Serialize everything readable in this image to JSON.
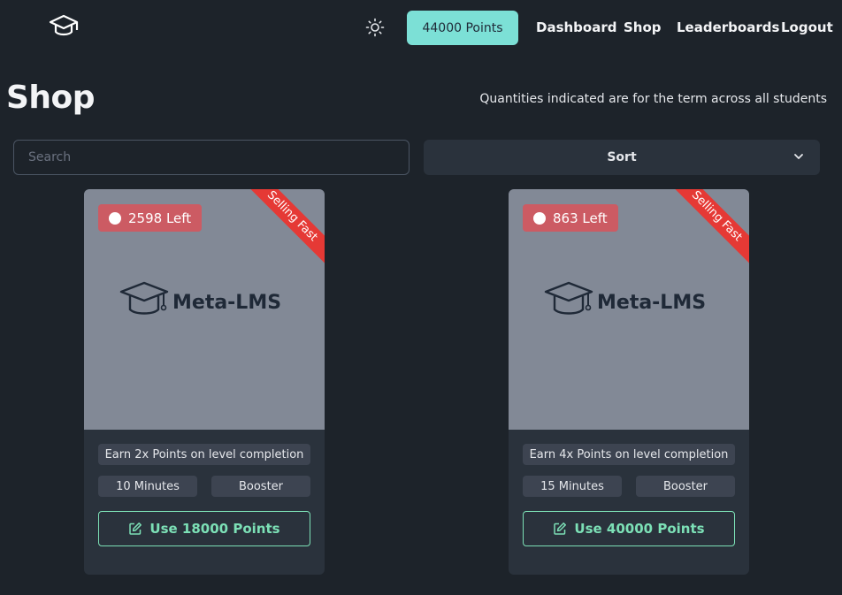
{
  "nav": {
    "points_label": "44000 Points",
    "links": [
      "Dashboard",
      "Shop",
      "Leaderboards",
      "Logout"
    ]
  },
  "page": {
    "title": "Shop",
    "note": "Quantities indicated are for the term across all students"
  },
  "search": {
    "placeholder": "Search",
    "value": ""
  },
  "sort": {
    "label": "Sort"
  },
  "items": [
    {
      "stock": "2598 Left",
      "ribbon": "Selling Fast",
      "brand": "Meta-LMS",
      "description": "Earn 2x Points on level completion",
      "duration": "10 Minutes",
      "type": "Booster",
      "cta": "Use 18000 Points"
    },
    {
      "stock": "863 Left",
      "ribbon": "Selling Fast",
      "brand": "Meta-LMS",
      "description": "Earn 4x Points on level completion",
      "duration": "15 Minutes",
      "type": "Booster",
      "cta": "Use 40000 Points"
    }
  ],
  "colors": {
    "background": "#1d232a",
    "accent": "#7ce0d6",
    "success": "#7ce0b6",
    "danger": "#e53935"
  },
  "icons": [
    "graduation-cap-icon",
    "sun-icon",
    "chevron-down-icon",
    "edit-icon"
  ]
}
